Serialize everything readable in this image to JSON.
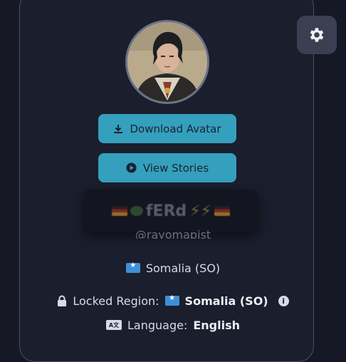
{
  "profile": {
    "display_name": "fERd",
    "username": "@rayomapist"
  },
  "buttons": {
    "download_label": "Download Avatar",
    "stories_label": "View Stories"
  },
  "details": {
    "country": "Somalia (SO)",
    "locked_region_label": "Locked Region:",
    "locked_region_value": "Somalia (SO)",
    "language_label": "Language:",
    "language_value": "English"
  },
  "icons": {
    "settings": "gear-icon",
    "download": "download-icon",
    "play": "play-circle-icon",
    "lock": "lock-icon",
    "info": "info-icon",
    "language": "language-icon"
  },
  "colors": {
    "background": "#161825",
    "card": "#1b1e2d",
    "accent": "#34a0bd",
    "settings_button": "#3a3f52"
  }
}
